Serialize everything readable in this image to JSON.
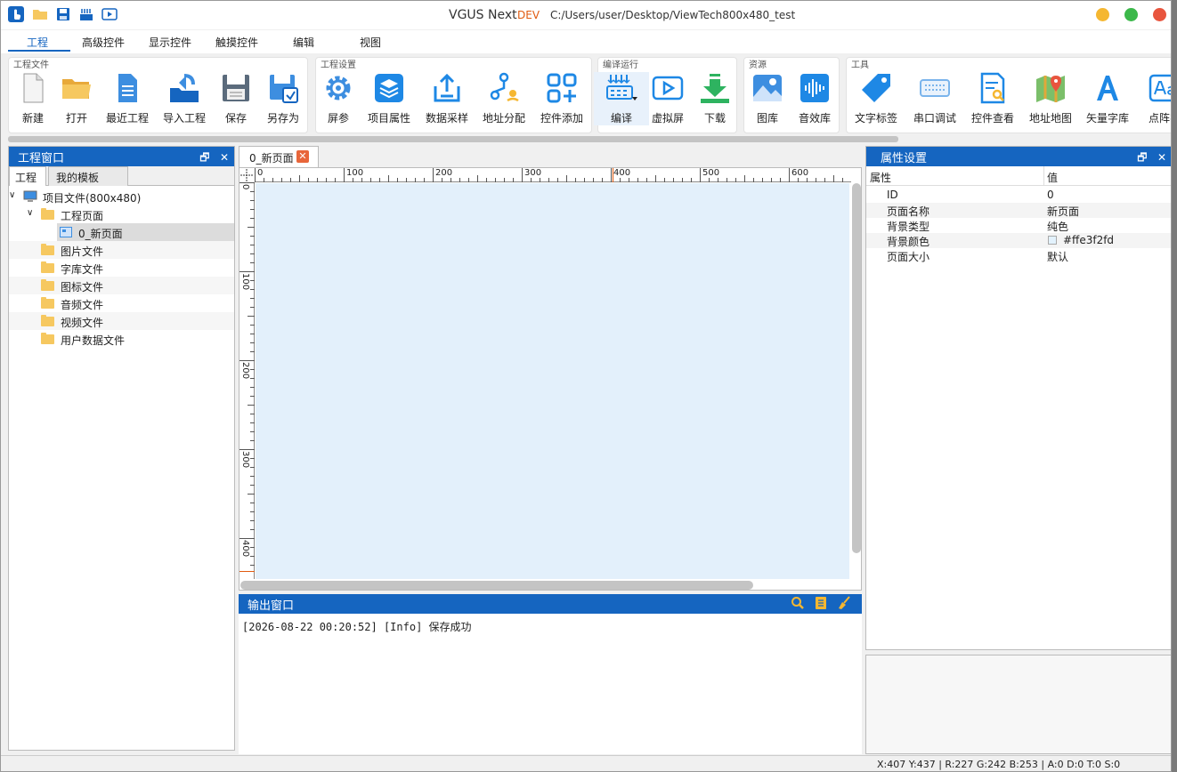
{
  "titlebar": {
    "app_name": "VGUS Next",
    "badge": "DEV",
    "path": "C:/Users/user/Desktop/ViewTech800x480_test"
  },
  "menu": {
    "tabs": [
      {
        "label": "工程",
        "active": true
      },
      {
        "label": "高级控件"
      },
      {
        "label": "显示控件"
      },
      {
        "label": "触摸控件"
      },
      {
        "label": "编辑"
      },
      {
        "label": "视图"
      }
    ]
  },
  "ribbon": {
    "groups": [
      {
        "label": "工程文件",
        "buttons": [
          "新建",
          "打开",
          "最近工程",
          "导入工程",
          "保存",
          "另存为"
        ]
      },
      {
        "label": "工程设置",
        "buttons": [
          "屏参",
          "项目属性",
          "数据采样",
          "地址分配",
          "控件添加"
        ]
      },
      {
        "label": "编译运行",
        "buttons": [
          "编译",
          "虚拟屏",
          "下载"
        ]
      },
      {
        "label": "资源",
        "buttons": [
          "图库",
          "音效库"
        ]
      },
      {
        "label": "工具",
        "buttons": [
          "文字标签",
          "串口调试",
          "控件查看",
          "地址地图",
          "矢量字库",
          "点阵字"
        ]
      }
    ]
  },
  "left_panel": {
    "title": "工程窗口",
    "tabs": [
      "工程",
      "我的模板"
    ],
    "tree": [
      {
        "label": "项目文件(800x480)",
        "level": 0
      },
      {
        "label": "工程页面",
        "level": 1
      },
      {
        "label": "0_新页面",
        "level": 2
      },
      {
        "label": "图片文件",
        "level": 1
      },
      {
        "label": "字库文件",
        "level": 1
      },
      {
        "label": "图标文件",
        "level": 1
      },
      {
        "label": "音频文件",
        "level": 1
      },
      {
        "label": "视频文件",
        "level": 1
      },
      {
        "label": "用户数据文件",
        "level": 1
      }
    ]
  },
  "editor": {
    "tab_label": "0_新页面",
    "ruler_h": [
      "0",
      "100",
      "200",
      "300",
      "400",
      "500",
      "600"
    ],
    "ruler_v": [
      "0",
      "100",
      "200",
      "300",
      "400"
    ]
  },
  "output": {
    "title": "输出窗口",
    "log": "[2026-08-22 00:20:52] [Info] 保存成功"
  },
  "properties": {
    "title": "属性设置",
    "col_key": "属性",
    "col_value": "值",
    "rows": [
      {
        "key": "ID",
        "value": "0"
      },
      {
        "key": "页面名称",
        "value": "新页面"
      },
      {
        "key": "背景类型",
        "value": "纯色"
      },
      {
        "key": "背景颜色",
        "value": "#ffe3f2fd"
      },
      {
        "key": "页面大小",
        "value": "默认"
      }
    ]
  },
  "status": {
    "text": "X:407  Y:437  |  R:227 G:242 B:253  |  A:0  D:0  T:0  S:0"
  },
  "colors": {
    "accent": "#1565c0",
    "canvas_bg": "#e3f0fb",
    "min_btn": "#f5b731",
    "max_btn": "#3cb84a",
    "close_btn": "#e8553e"
  }
}
